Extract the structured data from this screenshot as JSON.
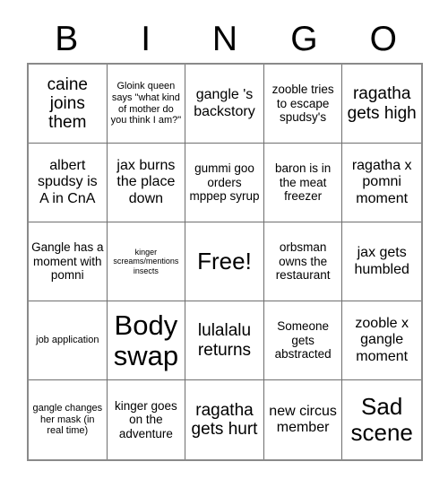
{
  "card": {
    "header_letters": [
      "B",
      "I",
      "N",
      "G",
      "O"
    ],
    "columns": 5,
    "rows": 5,
    "free_space_index": 12,
    "colors": {
      "background": "#ffffff",
      "text": "#000000",
      "grid_line": "#6f6f6f",
      "outer_border": "#8a8a8a"
    },
    "cells": [
      {
        "text": "caine joins them",
        "size": "xl"
      },
      {
        "text": "Gloink queen says \"what kind of mother do you think I am?\"",
        "size": "sm"
      },
      {
        "text": "gangle 's backstory",
        "size": "lg"
      },
      {
        "text": "zooble tries to escape spudsy's",
        "size": "md"
      },
      {
        "text": "ragatha gets high",
        "size": "xl"
      },
      {
        "text": "albert spudsy is A in CnA",
        "size": "lg"
      },
      {
        "text": "jax burns the place down",
        "size": "lg"
      },
      {
        "text": "gummi goo orders mppep syrup",
        "size": "md"
      },
      {
        "text": "baron is in the meat freezer",
        "size": "md"
      },
      {
        "text": "ragatha x pomni moment",
        "size": "lg"
      },
      {
        "text": "Gangle has a moment with pomni",
        "size": "md"
      },
      {
        "text": "kinger screams/mentions insects",
        "size": "xs"
      },
      {
        "text": "Free!",
        "size": "xxl"
      },
      {
        "text": "orbsman owns the restaurant",
        "size": "md"
      },
      {
        "text": "jax gets humbled",
        "size": "lg"
      },
      {
        "text": "job application",
        "size": "sm"
      },
      {
        "text": "Body swap",
        "size": "huge"
      },
      {
        "text": "lulalalu returns",
        "size": "xl"
      },
      {
        "text": "Someone gets abstracted",
        "size": "md"
      },
      {
        "text": "zooble x gangle moment",
        "size": "lg"
      },
      {
        "text": "gangle changes her mask (in real time)",
        "size": "sm"
      },
      {
        "text": "kinger goes on the adventure",
        "size": "md"
      },
      {
        "text": "ragatha gets hurt",
        "size": "xl"
      },
      {
        "text": "new circus member",
        "size": "lg"
      },
      {
        "text": "Sad scene",
        "size": "xxl"
      }
    ]
  }
}
